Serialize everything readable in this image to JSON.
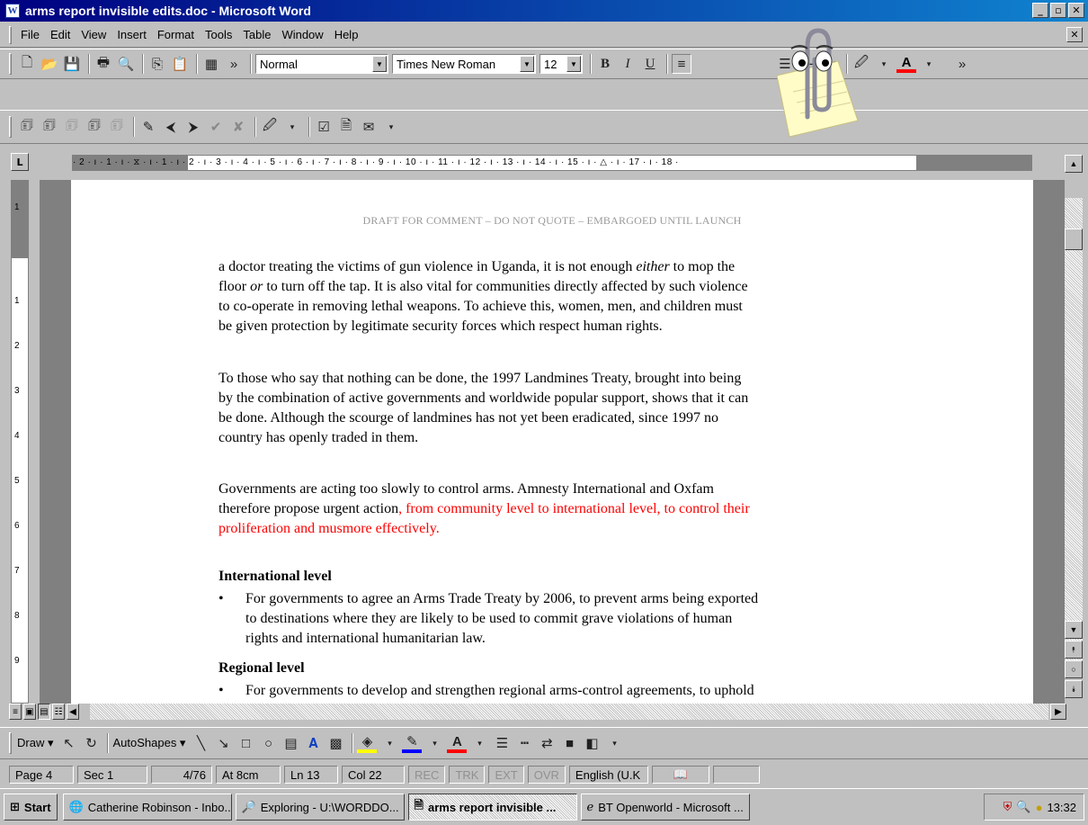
{
  "window": {
    "app_icon": "W",
    "title": "arms report invisible edits.doc - Microsoft Word",
    "min": "_",
    "max": "▫",
    "close": "✕"
  },
  "menu": {
    "items": [
      "File",
      "Edit",
      "View",
      "Insert",
      "Format",
      "Tools",
      "Table",
      "Window",
      "Help"
    ],
    "close_doc": "✕"
  },
  "toolbar": {
    "style_value": "Normal",
    "font_value": "Times New Roman",
    "size_value": "12",
    "bold": "B",
    "italic": "I",
    "underline": "U",
    "overflow": "»"
  },
  "ruler": {
    "tab_selector": "L",
    "ticks": "· 2 · ı · 1 · ı · ⧖ · ı · 1 · ı · 2 · ı · 3 · ı · 4 · ı · 5 · ı · 6 · ı · 7 · ı · 8 · ı · 9 · ı · 10 · ı · 11 · ı · 12 · ı · 13 · ı · 14 · ı · 15 · ı · △ · ı · 17 · ı · 18 ·",
    "vertical_numbers": [
      "1",
      "1",
      "2",
      "3",
      "4",
      "5",
      "6",
      "7",
      "8",
      "9"
    ]
  },
  "document": {
    "header": "DRAFT FOR COMMENT – DO NOT QUOTE – EMBARGOED UNTIL LAUNCH",
    "para1_lines": [
      [
        "a doctor treating the victims of gun violence in Uganda, it is not enough ",
        "either",
        " to mop the"
      ],
      [
        "floor ",
        "or",
        " to turn off the tap. It is also vital for communities directly affected by such violence"
      ],
      [
        "to co-operate in removing lethal weapons. To achieve this, women, men, and children must",
        "",
        ""
      ],
      [
        "be given protection by legitimate security forces which respect human rights.",
        "",
        ""
      ]
    ],
    "para2_lines": [
      "To those who say that nothing can be done, the 1997 Landmines Treaty, brought into being",
      "by the combination of active governments and worldwide popular support, shows that it can",
      "be done. Although the scourge of landmines has not yet been eradicated, since 1997 no",
      "country has openly traded in them."
    ],
    "para3_line1": "Governments are acting too slowly to control arms. Amnesty International and Oxfam",
    "para3_line2_black": "therefore propose urgent action",
    "para3_line2_red": ", from community level to international level, to control their",
    "para3_line3_red": "proliferation and musmore effectively.",
    "heading_international": "International level",
    "bullet1_lines": [
      "For governments to agree an Arms Trade Treaty by 2006, to prevent arms being exported",
      "to destinations where they are likely to be used to commit grave violations of human",
      "rights and international humanitarian law."
    ],
    "heading_regional": "Regional level",
    "bullet2_line1": "For governments to develop and strengthen regional arms-control agreements, to uphold",
    "bullet_char": "•"
  },
  "drawbar": {
    "draw_label": "Draw ▾",
    "autoshapes_label": "AutoShapes ▾"
  },
  "status": {
    "page": "Page 4",
    "sec": "Sec 1",
    "pages": "4/76",
    "at": "At 8cm",
    "ln": "Ln 13",
    "col": "Col 22",
    "rec": "REC",
    "trk": "TRK",
    "ext": "EXT",
    "ovr": "OVR",
    "language": "English (U.K"
  },
  "taskbar": {
    "start": "Start",
    "tasks": [
      "Catherine Robinson - Inbo...",
      "Exploring - U:\\WORDDO...",
      "arms report invisible ...",
      "BT Openworld - Microsoft ..."
    ],
    "clock": "13:32"
  },
  "colors": {
    "title_bar": "#000080",
    "tracked_change": "#ff0000",
    "header_text": "#999999"
  }
}
